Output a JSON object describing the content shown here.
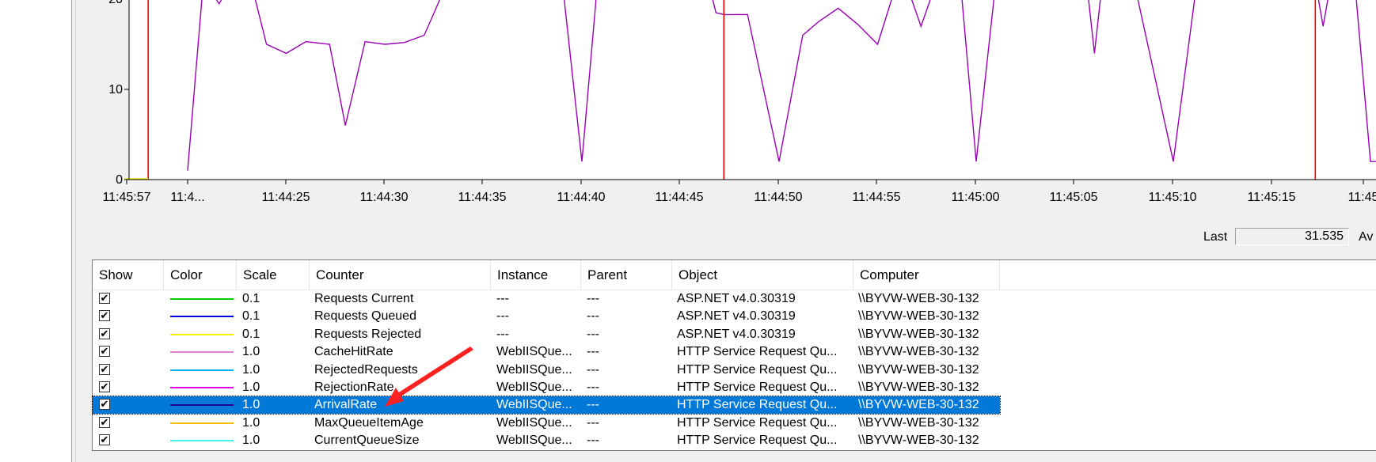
{
  "chart": {
    "y_ticks": [
      "0",
      "10",
      "20"
    ],
    "x_ticks": [
      "11:45:57",
      "11:4...",
      "11:44:25",
      "11:44:30",
      "11:44:35",
      "11:44:40",
      "11:44:45",
      "11:44:50",
      "11:44:55",
      "11:45:00",
      "11:45:05",
      "11:45:10",
      "11:45:15",
      "11:45"
    ],
    "colors": {
      "line": "#9a00b5",
      "cursor": "#ff0000",
      "yellow": "#f2e600"
    }
  },
  "chart_data": {
    "type": "line",
    "ylim": [
      0,
      20
    ],
    "series": [
      {
        "color": "#9a00b5",
        "points": [
          [
            0.0,
            1.0
          ],
          [
            0.4,
            22.0
          ],
          [
            0.8,
            19.5
          ],
          [
            1.1,
            21.8
          ],
          [
            1.6,
            22.0
          ],
          [
            2.0,
            15.0
          ],
          [
            2.5,
            14.0
          ],
          [
            3.0,
            15.3
          ],
          [
            3.6,
            15.0
          ],
          [
            4.0,
            6.0
          ],
          [
            4.5,
            15.3
          ],
          [
            5.0,
            15.0
          ],
          [
            5.5,
            15.2
          ],
          [
            6.0,
            16.0
          ],
          [
            6.6,
            22.0
          ],
          [
            9.5,
            22.0
          ],
          [
            10.0,
            2.0
          ],
          [
            10.4,
            22.0
          ],
          [
            13.2,
            22.0
          ],
          [
            13.4,
            18.5
          ],
          [
            13.6,
            18.3
          ],
          [
            14.2,
            18.3
          ],
          [
            15.0,
            2.0
          ],
          [
            15.6,
            16.0
          ],
          [
            16.0,
            17.5
          ],
          [
            16.5,
            19.0
          ],
          [
            17.0,
            17.2
          ],
          [
            17.5,
            15.0
          ],
          [
            18.0,
            22.0
          ],
          [
            18.2,
            22.0
          ],
          [
            18.6,
            17.0
          ],
          [
            19.0,
            22.0
          ],
          [
            19.6,
            22.0
          ],
          [
            20.0,
            2.0
          ],
          [
            20.5,
            22.0
          ],
          [
            22.8,
            22.0
          ],
          [
            23.0,
            14.0
          ],
          [
            23.2,
            22.0
          ],
          [
            24.0,
            22.0
          ],
          [
            25.0,
            2.0
          ],
          [
            25.6,
            22.0
          ],
          [
            28.6,
            22.0
          ],
          [
            28.8,
            17.0
          ],
          [
            29.0,
            22.0
          ],
          [
            29.6,
            22.0
          ],
          [
            30.0,
            2.0
          ],
          [
            30.2,
            2.0
          ]
        ]
      },
      {
        "color": "#ff0000",
        "points": [
          [
            -1.0,
            0
          ],
          [
            -1.0,
            22.0
          ]
        ]
      },
      {
        "color": "#ff0000",
        "points": [
          [
            13.6,
            0
          ],
          [
            13.6,
            22.0
          ]
        ]
      },
      {
        "color": "#ff0000",
        "points": [
          [
            28.6,
            0
          ],
          [
            28.6,
            22.0
          ]
        ]
      },
      {
        "color": "#f2e600",
        "points": [
          [
            -1.6,
            0.1
          ],
          [
            -1.0,
            0.1
          ]
        ]
      }
    ]
  },
  "stats": {
    "last_label": "Last",
    "last_value": "31.535",
    "avg_label": "Av"
  },
  "list": {
    "columns": [
      "Show",
      "Color",
      "Scale",
      "Counter",
      "Instance",
      "Parent",
      "Object",
      "Computer"
    ],
    "rows": [
      {
        "show": "✔",
        "color": "#00d000",
        "scale": "0.1",
        "counter": "Requests Current",
        "instance": "---",
        "parent": "---",
        "object": "ASP.NET v4.0.30319",
        "computer": "\\\\BYVW-WEB-30-132"
      },
      {
        "show": "✔",
        "color": "#0000e0",
        "scale": "0.1",
        "counter": "Requests Queued",
        "instance": "---",
        "parent": "---",
        "object": "ASP.NET v4.0.30319",
        "computer": "\\\\BYVW-WEB-30-132"
      },
      {
        "show": "✔",
        "color": "#f0f000",
        "scale": "0.1",
        "counter": "Requests Rejected",
        "instance": "---",
        "parent": "---",
        "object": "ASP.NET v4.0.30319",
        "computer": "\\\\BYVW-WEB-30-132"
      },
      {
        "show": "✔",
        "color": "#e080d0",
        "scale": "1.0",
        "counter": "CacheHitRate",
        "instance": "WebIISQue...",
        "parent": "---",
        "object": "HTTP Service Request Qu...",
        "computer": "\\\\BYVW-WEB-30-132"
      },
      {
        "show": "✔",
        "color": "#00b0f0",
        "scale": "1.0",
        "counter": "RejectedRequests",
        "instance": "WebIISQue...",
        "parent": "---",
        "object": "HTTP Service Request Qu...",
        "computer": "\\\\BYVW-WEB-30-132"
      },
      {
        "show": "✔",
        "color": "#e000e0",
        "scale": "1.0",
        "counter": "RejectionRate",
        "instance": "WebIISQue...",
        "parent": "---",
        "object": "HTTP Service Request Qu...",
        "computer": "\\\\BYVW-WEB-30-132"
      },
      {
        "show": "✔",
        "color": "#2000a0",
        "scale": "1.0",
        "counter": "ArrivalRate",
        "instance": "WebIISQue...",
        "parent": "---",
        "object": "HTTP Service Request Qu...",
        "computer": "\\\\BYVW-WEB-30-132",
        "selected": true
      },
      {
        "show": "✔",
        "color": "#f0c000",
        "scale": "1.0",
        "counter": "MaxQueueItemAge",
        "instance": "WebIISQue...",
        "parent": "---",
        "object": "HTTP Service Request Qu...",
        "computer": "\\\\BYVW-WEB-30-132"
      },
      {
        "show": "✔",
        "color": "#40f0f0",
        "scale": "1.0",
        "counter": "CurrentQueueSize",
        "instance": "WebIISQue...",
        "parent": "---",
        "object": "HTTP Service Request Qu...",
        "computer": "\\\\BYVW-WEB-30-132"
      }
    ]
  },
  "annotation": {
    "arrow_color": "#ff2020"
  }
}
